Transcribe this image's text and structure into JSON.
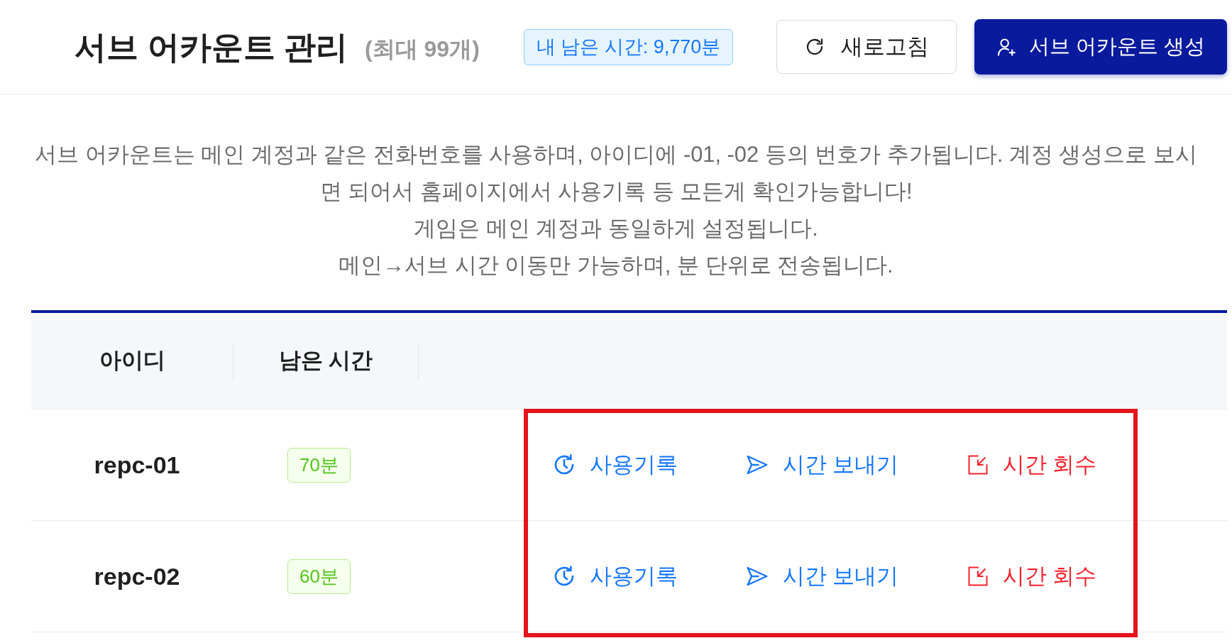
{
  "header": {
    "title": "서브 어카운트 관리",
    "limit": "(최대 99개)",
    "balance": "내 남은 시간: 9,770분",
    "buttons": [
      {
        "kind": "refresh",
        "label": "새로고침"
      },
      {
        "kind": "create",
        "label": "서브 어카운트 생성"
      }
    ]
  },
  "notice": [
    "서브 어카운트는 메인 계정과 같은 전화번호를 사용하며, 아이디에 -01, -02 등의 번호가 추가됩니다. 계정 생성으로 보시면 되어서 홈페이지에서 사용기록 등 모든게 확인가능합니다!",
    "게임은 메인 계정과 동일하게 설정됩니다.",
    "메인→서브 시간 이동만 가능하며, 분 단위로 전송됩니다."
  ],
  "table": {
    "columns": [
      "아이디",
      "남은 시간"
    ],
    "actions_highlighted": true,
    "rows": [
      {
        "id": "repc-01",
        "remaining": "70분",
        "actions": [
          {
            "kind": "history",
            "label": "사용기록"
          },
          {
            "kind": "send",
            "label": "시간 보내기"
          },
          {
            "kind": "reclaim",
            "label": "시간 회수"
          }
        ]
      },
      {
        "id": "repc-02",
        "remaining": "60분",
        "actions": [
          {
            "kind": "history",
            "label": "사용기록"
          },
          {
            "kind": "send",
            "label": "시간 보내기"
          },
          {
            "kind": "reclaim",
            "label": "시간 회수"
          }
        ]
      }
    ]
  }
}
